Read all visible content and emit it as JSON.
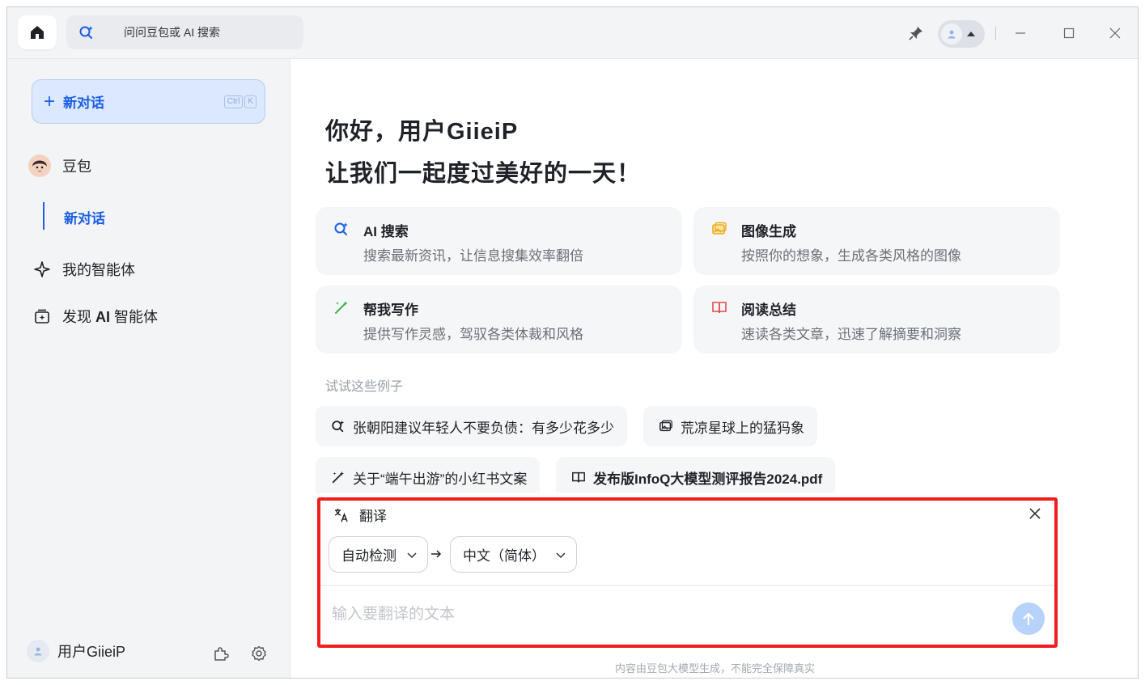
{
  "titlebar": {
    "search_placeholder": "问问豆包或 AI 搜索"
  },
  "sidebar": {
    "new_chat_label": "新对话",
    "new_chat_shortcut": [
      "Ctrl",
      "K"
    ],
    "bot_name": "豆包",
    "bot_sub_item": "新对话",
    "nav_my_agents": "我的智能体",
    "nav_discover_prefix": "发现 ",
    "nav_discover_ai": "AI",
    "nav_discover_suffix": " 智能体",
    "user_name": "用户GiieiP"
  },
  "main": {
    "greeting_line1": "你好，用户GiieiP",
    "greeting_line2": "让我们一起度过美好的一天！",
    "cards": [
      {
        "title": "AI 搜索",
        "desc": "搜索最新资讯，让信息搜集效率翻倍",
        "icon": "ai-search-icon"
      },
      {
        "title": "图像生成",
        "desc": "按照你的想象，生成各类风格的图像",
        "icon": "image-gen-icon"
      },
      {
        "title": "帮我写作",
        "desc": "提供写作灵感，驾驭各类体裁和风格",
        "icon": "writing-icon"
      },
      {
        "title": "阅读总结",
        "desc": "速读各类文章，迅速了解摘要和洞察",
        "icon": "reading-icon"
      }
    ],
    "try_label": "试试这些例子",
    "examples": [
      "张朝阳建议年轻人不要负债：有多少花多少",
      "荒凉星球上的猛犸象",
      "关于“端午出游”的小红书文案",
      "发布版InfoQ大模型测评报告2024.pdf"
    ],
    "translate": {
      "title": "翻译",
      "source_lang": "自动检测",
      "target_lang": "中文（简体）",
      "input_placeholder": "输入要翻译的文本"
    },
    "disclaimer": "内容由豆包大模型生成，不能完全保障真实"
  },
  "colors": {
    "accent": "#1a5ee6",
    "highlight_frame": "#f21d1d",
    "send_button": "#b7d2fb"
  }
}
